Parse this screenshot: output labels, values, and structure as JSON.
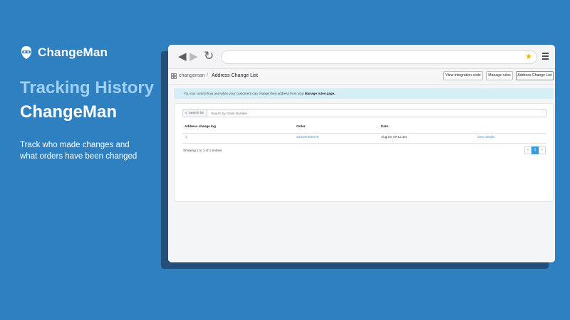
{
  "brand": {
    "name": "ChangeMan"
  },
  "hero": {
    "headline_top": "Tracking History",
    "headline_bottom": "ChangeMan",
    "description": "Track who made changes and what orders have been changed"
  },
  "browser": {
    "url": ""
  },
  "app": {
    "breadcrumb_app": "changeman",
    "breadcrumb_separator": "/",
    "breadcrumb_page": "Address Change List",
    "buttons": {
      "view_integration": "View integration code",
      "manage_rules": "Manage rules",
      "address_change_list": "Address Change List"
    }
  },
  "banner": {
    "text": "You can control how and when your customers can change their address from your",
    "link": "Manage rules page."
  },
  "search": {
    "label": "Search for",
    "placeholder": "Search by Order Number"
  },
  "table": {
    "headers": [
      "Address change log",
      "Order",
      "Date",
      ""
    ],
    "rows": [
      {
        "log": "1",
        "order": "S15347528479",
        "date": "Aug 10, 07:11 am",
        "action": "View details"
      }
    ]
  },
  "footer": {
    "entries": "Showing 1 to 1 of 1 entries",
    "pager": {
      "prev": "«",
      "current": "1",
      "next": "»"
    }
  },
  "colors": {
    "background": "#2f80c0",
    "accent": "#3d9ad8",
    "headline_light": "#9fd0f4"
  }
}
